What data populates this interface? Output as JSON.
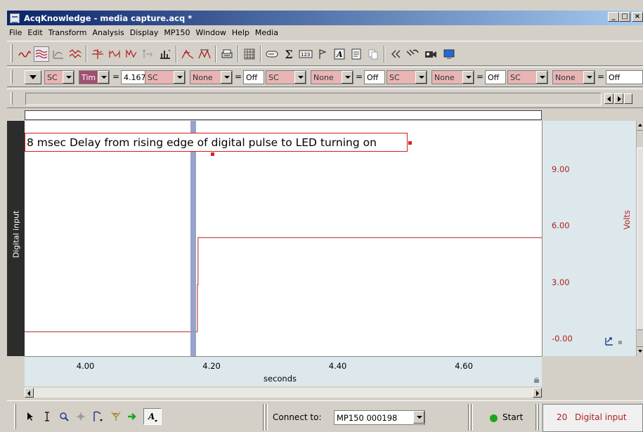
{
  "window": {
    "title": "AcqKnowledge - media capture.acq *",
    "minimize": "_",
    "maximize": "□",
    "close": "×"
  },
  "menu": [
    "File",
    "Edit",
    "Transform",
    "Analysis",
    "Display",
    "MP150",
    "Window",
    "Help",
    "Media"
  ],
  "measurement_bar": {
    "m1_source": "SC",
    "m1_type": "Tim",
    "m1_equals": "=",
    "m1_value": "4.1670",
    "m2_source": "SC",
    "m2_type": "None",
    "m2_equals": "=",
    "m2_value": "Off",
    "m3_source": "SC",
    "m3_type": "None",
    "m3_equals": "=",
    "m3_value": "Off",
    "m4_source": "SC",
    "m4_type": "None",
    "m4_equals": "=",
    "m4_value": "Off",
    "m5_source": "SC",
    "m5_type": "None",
    "m5_equals": "=",
    "m5_value": "Off"
  },
  "channel": {
    "label": "Digital input",
    "unit": "Volts",
    "color": "#b02020",
    "number": "20",
    "name": "Digital input"
  },
  "annotation": "8 msec Delay from rising edge of digital pulse to LED turning on",
  "chart_data": {
    "type": "line",
    "xlabel": "seconds",
    "ylabel": "Volts",
    "x_ticks": [
      "4.00",
      "4.20",
      "4.40",
      "4.60"
    ],
    "y_ticks": [
      "9.00",
      "6.00",
      "3.00",
      "-0.00"
    ],
    "xlim": [
      3.9,
      4.72
    ],
    "ylim": [
      -1.3,
      11.2
    ],
    "cursor_x": 4.167,
    "series": [
      {
        "color": "#b02020",
        "x": [
          3.9,
          4.174,
          4.174,
          4.175,
          4.175,
          4.72
        ],
        "y": [
          0.0,
          0.0,
          2.5,
          2.5,
          5.0,
          5.0
        ]
      }
    ]
  },
  "bottom": {
    "connect_label": "Connect to:",
    "connect_value": "MP150 000198",
    "start_label": "Start"
  }
}
